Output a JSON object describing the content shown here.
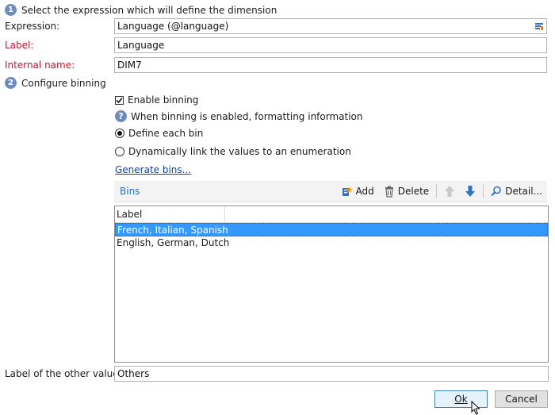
{
  "section1": {
    "number": "1",
    "title": "Select the expression which will define the dimension"
  },
  "expression": {
    "label": "Expression:",
    "value": "Language (@language)"
  },
  "label": {
    "label": "Label:",
    "value": "Language"
  },
  "internal_name": {
    "label": "Internal name:",
    "value": "DIM7"
  },
  "section2": {
    "number": "2",
    "title": "Configure binning"
  },
  "enable_binning": {
    "label": "Enable binning",
    "checked": true
  },
  "info_text": "When binning is enabled, formatting information",
  "radio_define": "Define each bin",
  "radio_dynamic": "Dynamically link the values to an enumeration",
  "generate_link": "Generate bins...",
  "toolbar": {
    "title": "Bins",
    "add": "Add",
    "delete": "Delete",
    "detail": "Detail..."
  },
  "bins_list": {
    "column": "Label",
    "rows": [
      "French, Italian, Spanish",
      "English, German, Dutch"
    ]
  },
  "other_values": {
    "label": "Label of the other values:",
    "value": "Others"
  },
  "buttons": {
    "ok": "Ok",
    "cancel": "Cancel"
  },
  "colors": {
    "accent": "#6d8cc0",
    "required": "#c8102e",
    "selection": "#3399ff",
    "link": "#0645ad"
  }
}
